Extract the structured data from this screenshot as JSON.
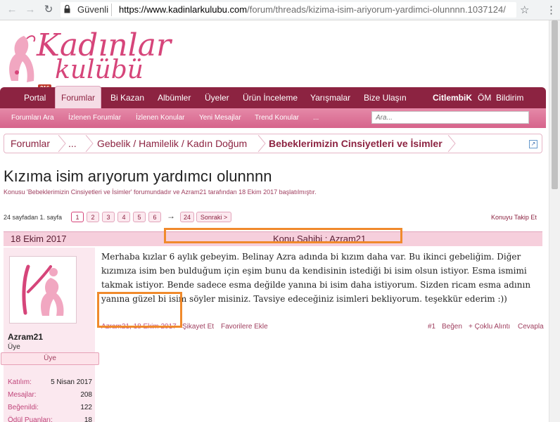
{
  "browser": {
    "secure_label": "Güvenli",
    "url_host": "https://www.kadinlarkulubu.com",
    "url_path": "/forum/threads/kizima-isim-ariyorum-yardimci-olunnnn.1037124/"
  },
  "logo": {
    "line1": "Kadınlar",
    "line2": "kulübü",
    "badge": "216"
  },
  "main_nav": {
    "items": [
      "Portal",
      "Forumlar",
      "Bi Kazan",
      "Albümler",
      "Üyeler",
      "Ürün İnceleme",
      "Yarışmalar",
      "Bize Ulaşın"
    ],
    "right_items": [
      "CitlembiK",
      "ÖM",
      "Bildirim"
    ]
  },
  "sub_nav": {
    "items": [
      "Forumları Ara",
      "İzlenen Forumlar",
      "İzlenen Konular",
      "Yeni Mesajlar",
      "Trend Konular",
      "..."
    ],
    "search_placeholder": "Ara..."
  },
  "breadcrumb": [
    "Forumlar",
    "...",
    "Gebelik / Hamilelik / Kadın Doğum",
    "Bebeklerimizin Cinsiyetleri ve İsimler"
  ],
  "thread": {
    "title": "Kızıma isim arıyorum yardımcı olunnnn",
    "description": "Konusu 'Bebeklerimizin Cinsiyetleri ve İsimler' forumundadır ve Azram21 tarafından 18 Ekim 2017 başlatılmıştır."
  },
  "pager": {
    "label": "24 sayfadan 1. sayfa",
    "pages": [
      "1",
      "2",
      "3",
      "4",
      "5",
      "6"
    ],
    "arrow": "→",
    "last": "24",
    "next": "Sonraki >",
    "watch": "Konuyu Takip Et"
  },
  "post": {
    "date": "18 Ekim 2017",
    "owner": "Konu Sahibi : Azram21",
    "message": "Merhaba kızlar 6 aylık gebeyim. Belinay Azra adında bi kızım daha var. Bu ikinci gebeliğim. Diğer kızımıza isim ben bulduğum için eşim bunu da kendisinin istediği bi isim olsun istiyor. Esma ismimi takmak istiyor. Bende sadece esma değilde yanına bi isim daha istiyorum. Sizden ricam esma adının yanına güzel bi isim söyler misiniz. Tavsiye edeceğiniz isimleri bekliyorum. teşekkür ederim :))",
    "footer": {
      "author_date": "Azram21, 18 Ekim 2017",
      "report": "Şikayet Et",
      "favorite": "Favorilere Ekle",
      "number": "#1",
      "like": "Beğen",
      "multiquote": "+ Çoklu Alıntı",
      "reply": "Cevapla"
    }
  },
  "user": {
    "name": "Azram21",
    "title": "Üye",
    "banner": "Üye",
    "stats": [
      {
        "label": "Katılım:",
        "value": "5 Nisan 2017"
      },
      {
        "label": "Mesajlar:",
        "value": "208"
      },
      {
        "label": "Beğenildi:",
        "value": "122"
      },
      {
        "label": "Ödül Puanları:",
        "value": "18"
      }
    ]
  },
  "colors": {
    "brand": "#8c2341",
    "accent": "#d6457a",
    "highlight": "#f08a2c"
  }
}
